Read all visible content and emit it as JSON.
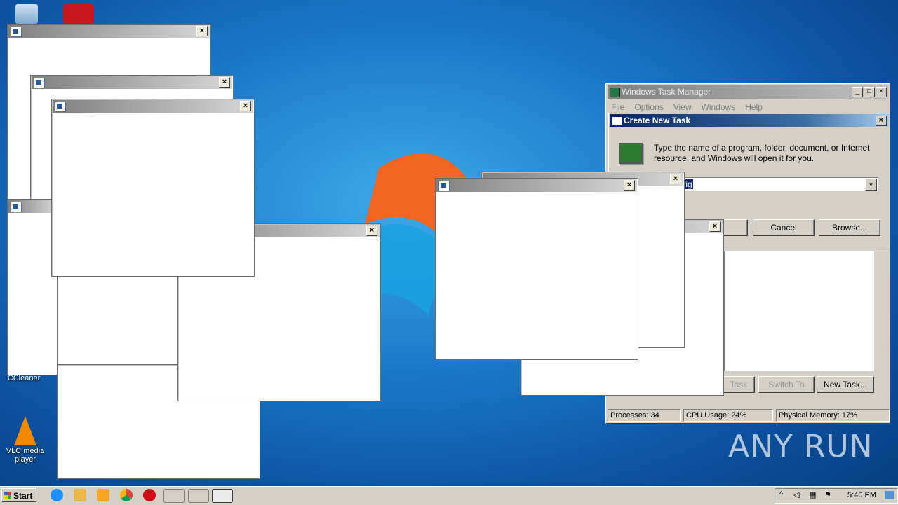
{
  "desktop": {
    "icons": [
      {
        "name": "recycle-bin-icon",
        "label": ""
      },
      {
        "name": "acrobat-icon",
        "label": ""
      },
      {
        "name": "ccleaner-icon",
        "label": "CCleaner"
      },
      {
        "name": "vlc-icon",
        "label": "VLC media player"
      }
    ],
    "watermark": "ANY RUN"
  },
  "task_manager": {
    "title": "Windows Task Manager",
    "menu": [
      "File",
      "Options",
      "View",
      "Windows",
      "Help"
    ],
    "buttons": {
      "end_task": "Task",
      "switch_to": "Switch To",
      "new_task": "New Task..."
    },
    "status": {
      "processes": "Processes: 34",
      "cpu": "CPU Usage: 24%",
      "memory": "Physical Memory: 17%"
    }
  },
  "create_task": {
    "title": "Create New Task",
    "message": "Type the name of a program, folder, document, or Internet resource, and Windows will open it for you.",
    "input_value": "fig",
    "cancel": "Cancel",
    "browse": "Browse..."
  },
  "taskbar": {
    "start": "Start",
    "clock": "5:40 PM"
  },
  "colors": {
    "accent": "#0a246a",
    "desktop": "#1a78c9"
  }
}
